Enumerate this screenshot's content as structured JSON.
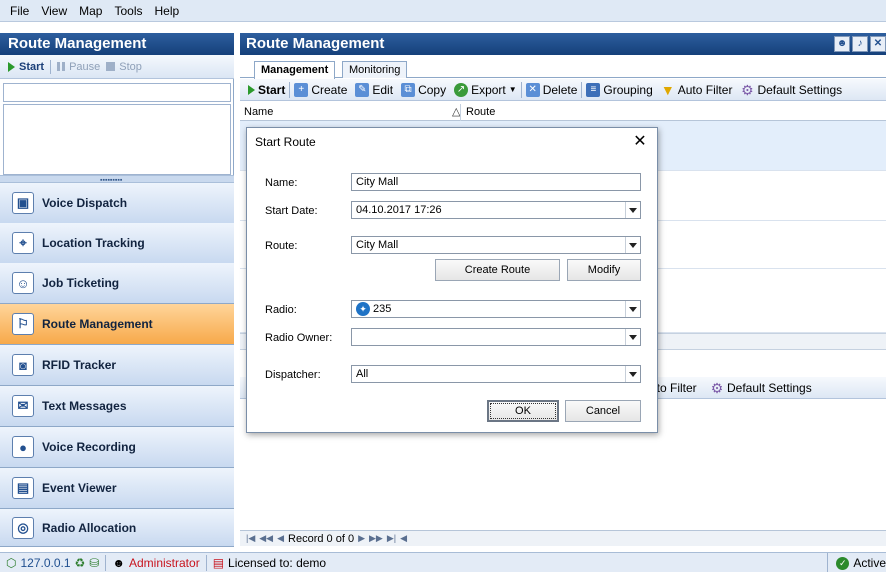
{
  "menu": [
    "File",
    "View",
    "Map",
    "Tools",
    "Help"
  ],
  "left": {
    "title": "Route Management",
    "controls": {
      "start": "Start",
      "pause": "Pause",
      "stop": "Stop"
    },
    "nav": [
      {
        "label": "Voice Dispatch",
        "icon": "voice-dispatch-icon"
      },
      {
        "label": "Location Tracking",
        "icon": "location-tracking-icon"
      },
      {
        "label": "Job Ticketing",
        "icon": "job-ticketing-icon"
      },
      {
        "label": "Route Management",
        "icon": "route-management-icon",
        "active": true
      },
      {
        "label": "RFID Tracker",
        "icon": "rfid-tracker-icon"
      },
      {
        "label": "Text Messages",
        "icon": "text-messages-icon"
      },
      {
        "label": "Voice Recording",
        "icon": "voice-recording-icon"
      },
      {
        "label": "Event Viewer",
        "icon": "event-viewer-icon"
      },
      {
        "label": "Radio Allocation",
        "icon": "radio-allocation-icon"
      }
    ]
  },
  "right": {
    "title": "Route Management",
    "tabs": [
      "Management",
      "Monitoring"
    ],
    "toolbar": {
      "start": "Start",
      "create": "Create",
      "edit": "Edit",
      "copy": "Copy",
      "export": "Export",
      "delete": "Delete",
      "grouping": "Grouping",
      "auto_filter": "Auto Filter",
      "default_settings": "Default Settings"
    },
    "grid": {
      "col_name": "Name",
      "col_route": "Route"
    },
    "toolbar2": {
      "auto_filter_partial": "uto Filter",
      "default_settings": "Default Settings"
    },
    "record_nav": "Record 0 of 0"
  },
  "status": {
    "ip": "127.0.0.1",
    "user": "Administrator",
    "license": "Licensed to: demo",
    "state": "Active"
  },
  "dialog": {
    "title": "Start Route",
    "name_label": "Name:",
    "name_value": "City Mall",
    "start_date_label": "Start Date:",
    "start_date_value": "04.10.2017 17:26",
    "route_label": "Route:",
    "route_value": "City Mall",
    "create_route": "Create Route",
    "modify": "Modify",
    "radio_label": "Radio:",
    "radio_value": "235",
    "radio_owner_label": "Radio Owner:",
    "radio_owner_value": "",
    "dispatcher_label": "Dispatcher:",
    "dispatcher_value": "All",
    "ok": "OK",
    "cancel": "Cancel"
  },
  "colors": {
    "header_blue": "#1f4f8f",
    "active_nav": "#f7a94a",
    "status_admin": "#c8141e"
  }
}
